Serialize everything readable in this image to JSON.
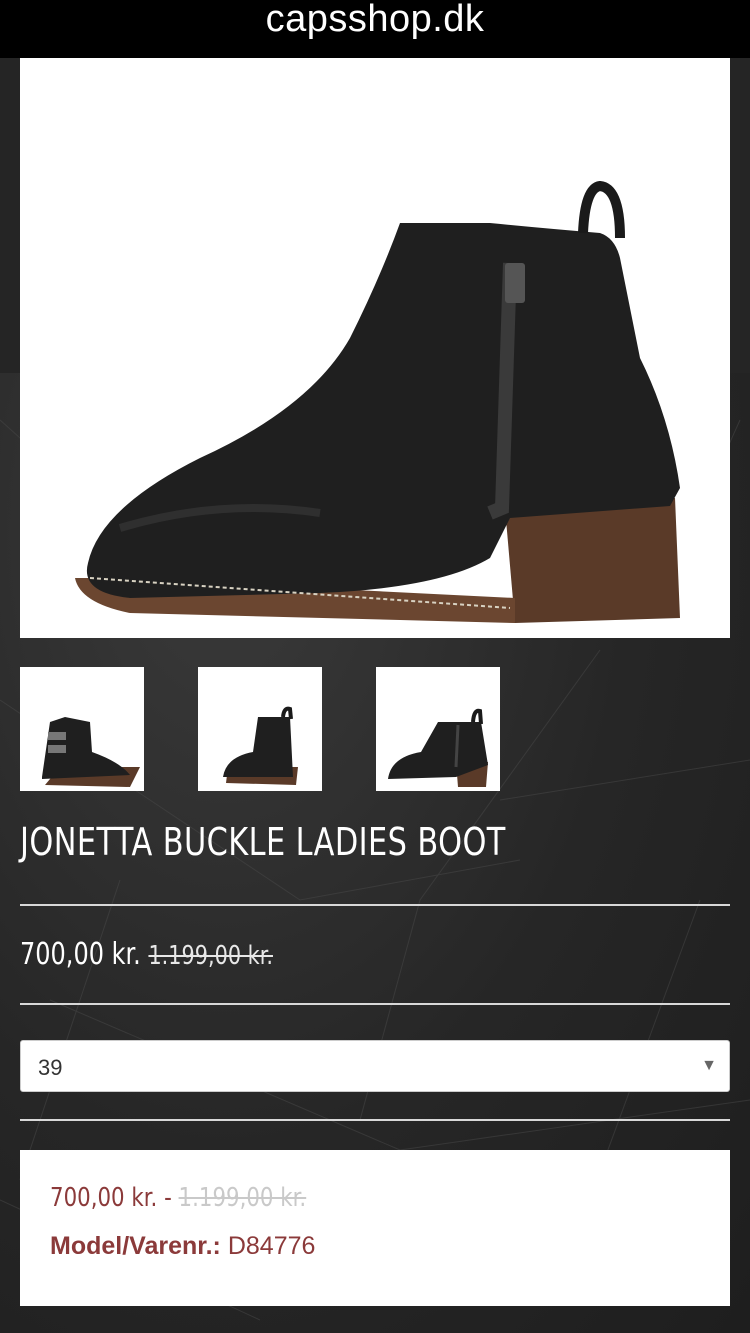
{
  "browser": {
    "url": "capsshop.dk"
  },
  "product": {
    "title": "JONETTA BUCKLE LADIES BOOT",
    "price": "700,00 kr.",
    "old_price": "1.199,00 kr.",
    "size_selected": "39",
    "summary_price": "700,00 kr. -",
    "summary_old_price": "1.199,00 kr.",
    "model_label": "Model/Varenr.:",
    "model_value": "D84776"
  },
  "images": {
    "main": "black-leather-ankle-boot-side-view",
    "thumbnails": [
      "boot-outer-side-buckle",
      "boot-front-angle",
      "boot-inner-side-zip"
    ]
  },
  "colors": {
    "accent": "#8b3a3a",
    "background": "#2a2a2a",
    "boot": "#1f1f1f",
    "heel": "#5a3a28"
  }
}
